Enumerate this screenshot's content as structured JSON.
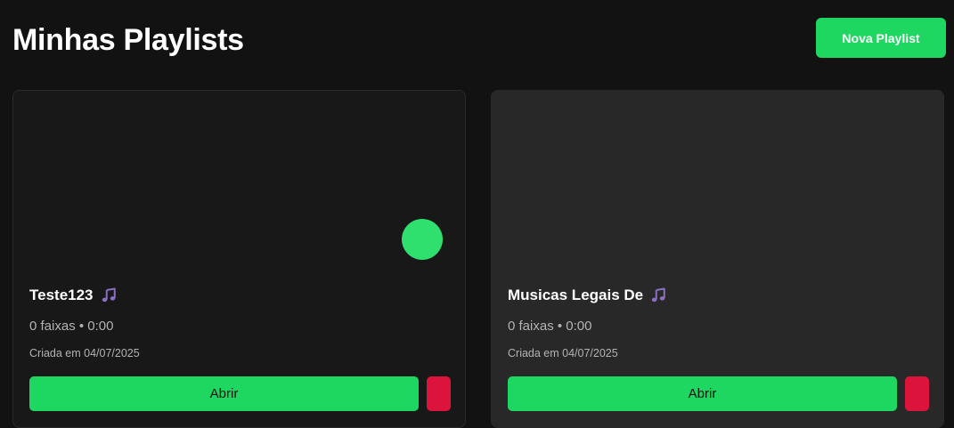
{
  "header": {
    "title": "Minhas Playlists",
    "new_playlist_label": "Nova Playlist"
  },
  "playlists": [
    {
      "name": "Teste123",
      "icon": "music-note-icon",
      "meta": "0 faixas • 0:00",
      "created": "Criada em 04/07/2025",
      "open_label": "Abrir",
      "play_button_visible": true
    },
    {
      "name": "Musicas Legais De",
      "icon": "music-note-icon",
      "meta": "0 faixas • 0:00",
      "created": "Criada em 04/07/2025",
      "open_label": "Abrir",
      "play_button_visible": false
    }
  ],
  "colors": {
    "accent": "#1ed760",
    "danger": "#dc143c",
    "background": "#121212",
    "card": "#181818",
    "card_hover": "#282828",
    "icon": "#8b6fc4"
  }
}
